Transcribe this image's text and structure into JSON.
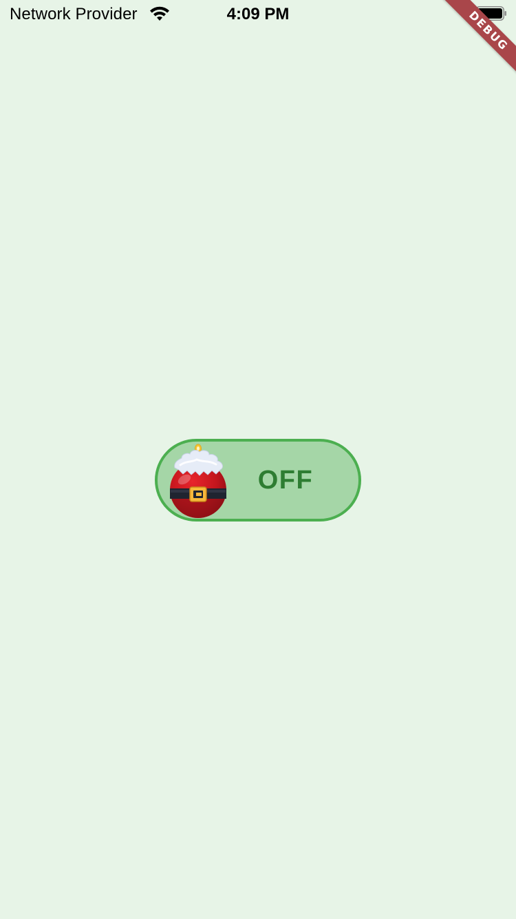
{
  "status_bar": {
    "carrier": "Network Provider",
    "time": "4:09 PM",
    "wifi_icon": "wifi-icon",
    "battery_icon": "battery-icon"
  },
  "debug_banner": {
    "label": "DEBUG",
    "color": "#a9464a"
  },
  "toggle": {
    "label": "OFF",
    "state": "off",
    "knob_icon": "christmas-ornament-icon",
    "colors": {
      "background": "#e7f4e7",
      "track_fill": "#a5d6a7",
      "track_border": "#4caf50",
      "label": "#2e7d32"
    }
  }
}
